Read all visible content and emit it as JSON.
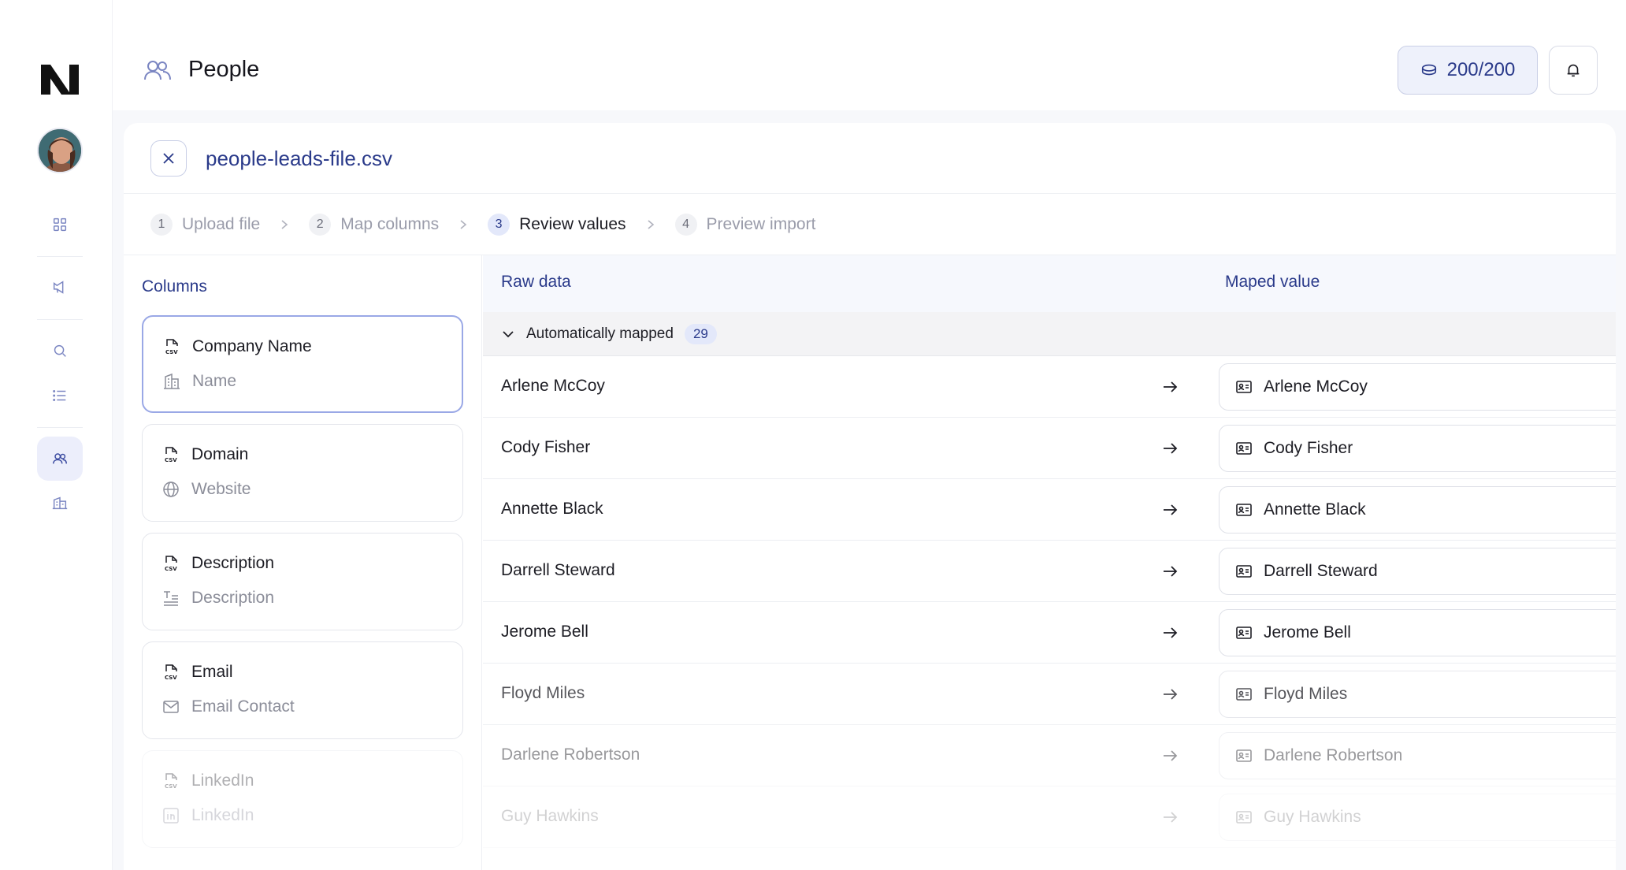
{
  "header": {
    "title": "People",
    "credits": "200/200"
  },
  "file": {
    "name": "people-leads-file.csv"
  },
  "steps": [
    {
      "num": "1",
      "label": "Upload file"
    },
    {
      "num": "2",
      "label": "Map columns"
    },
    {
      "num": "3",
      "label": "Review values"
    },
    {
      "num": "4",
      "label": "Preview import"
    }
  ],
  "columns": {
    "title": "Columns",
    "items": [
      {
        "source": "Company Name",
        "target": "Name",
        "target_icon": "building-icon"
      },
      {
        "source": "Domain",
        "target": "Website",
        "target_icon": "globe-icon"
      },
      {
        "source": "Description",
        "target": "Description",
        "target_icon": "text-icon"
      },
      {
        "source": "Email",
        "target": "Email Contact",
        "target_icon": "mail-icon"
      },
      {
        "source": "LinkedIn",
        "target": "LinkedIn",
        "target_icon": "linkedin-icon"
      }
    ]
  },
  "table": {
    "raw_header": "Raw data",
    "mapped_header": "Maped value",
    "group": {
      "label": "Automatically mapped",
      "count": "29"
    },
    "rows": [
      {
        "raw": "Arlene McCoy",
        "mapped": "Arlene McCoy"
      },
      {
        "raw": "Cody Fisher",
        "mapped": "Cody Fisher"
      },
      {
        "raw": "Annette Black",
        "mapped": "Annette Black"
      },
      {
        "raw": "Darrell Steward",
        "mapped": "Darrell Steward"
      },
      {
        "raw": "Jerome Bell",
        "mapped": "Jerome Bell"
      },
      {
        "raw": "Floyd Miles",
        "mapped": "Floyd Miles"
      },
      {
        "raw": "Darlene Robertson",
        "mapped": "Darlene Robertson"
      },
      {
        "raw": "Guy Hawkins",
        "mapped": "Guy Hawkins"
      }
    ]
  },
  "colors": {
    "accent": "#2a3a8a",
    "accent_light": "#e3e8fa",
    "border": "#e4e6ec"
  }
}
